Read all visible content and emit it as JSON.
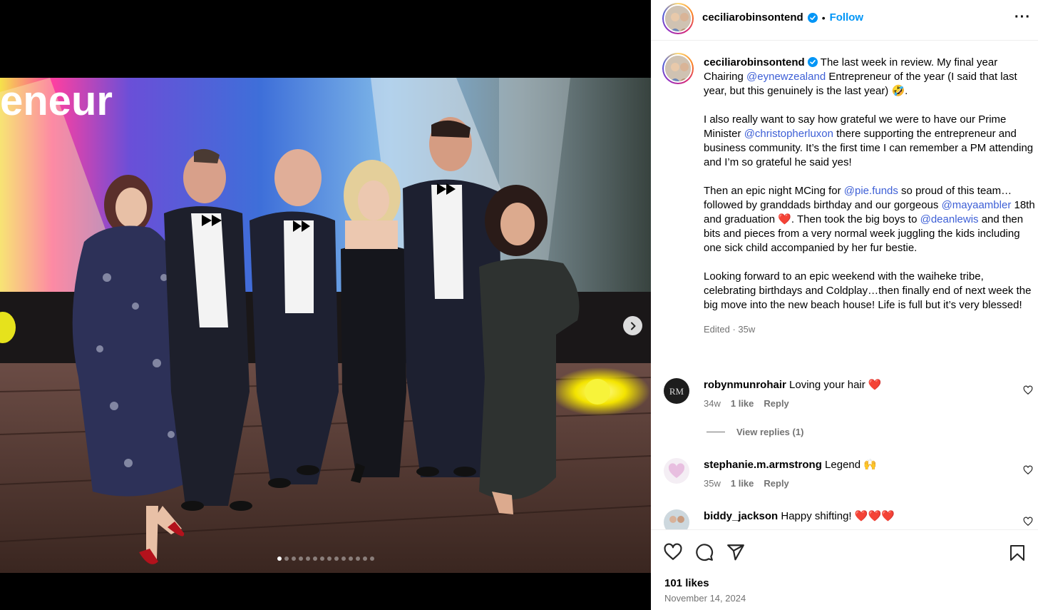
{
  "post": {
    "username": "ceciliarobinsontend",
    "follow_label": "Follow",
    "more_label": "···",
    "separator": "•",
    "caption": {
      "p1_lead": "The last week in review. My final year Chairing ",
      "p1_mention": "@eynewzealand",
      "p1_tail": " Entrepreneur of the year (I said that last year, but this genuinely is the last year) 🤣.",
      "p2_lead": "I also really want to say how grateful we were to have our Prime Minister ",
      "p2_mention": "@christopherluxon",
      "p2_tail": " there supporting the entrepreneur and business community. It’s the first time I can remember a PM attending and I’m so grateful he said yes!",
      "p3_lead": "Then an epic night MCing for ",
      "p3_mention1": "@pie.funds",
      "p3_mid": " so proud of this team… followed by granddads birthday and our gorgeous ",
      "p3_mention2": "@mayaambler",
      "p3_mid2": " 18th and graduation ❤️. Then took the big boys to ",
      "p3_mention3": "@deanlewis",
      "p3_tail": " and then bits and pieces from a very normal week juggling the kids including one sick child accompanied by her fur bestie.",
      "p4": "Looking forward to an epic weekend with the waiheke tribe, celebrating birthdays and Coldplay…then finally end of next week the big move into the new beach house! Life is full but it’s very blessed!",
      "edited": "Edited · 35w"
    },
    "comments": [
      {
        "user": "robynmunrohair",
        "text": "Loving your hair ❤️",
        "time": "34w",
        "likes": "1 like",
        "reply": "Reply",
        "avatar_text": "RM"
      },
      {
        "user": "stephanie.m.armstrong",
        "text": "Legend 🙌",
        "time": "35w",
        "likes": "1 like",
        "reply": "Reply"
      },
      {
        "user": "biddy_jackson",
        "text": "Happy shifting! ❤️❤️❤️"
      }
    ],
    "view_replies": "View replies (1)",
    "likes": "101 likes",
    "date": "November 14, 2024",
    "photo_sign_text": "eneur",
    "carousel": {
      "count": 14,
      "active": 0
    }
  },
  "colors": {
    "link": "#3d5fd6",
    "follow": "#0095f6",
    "verified": "#0095f6",
    "muted": "#737373"
  }
}
